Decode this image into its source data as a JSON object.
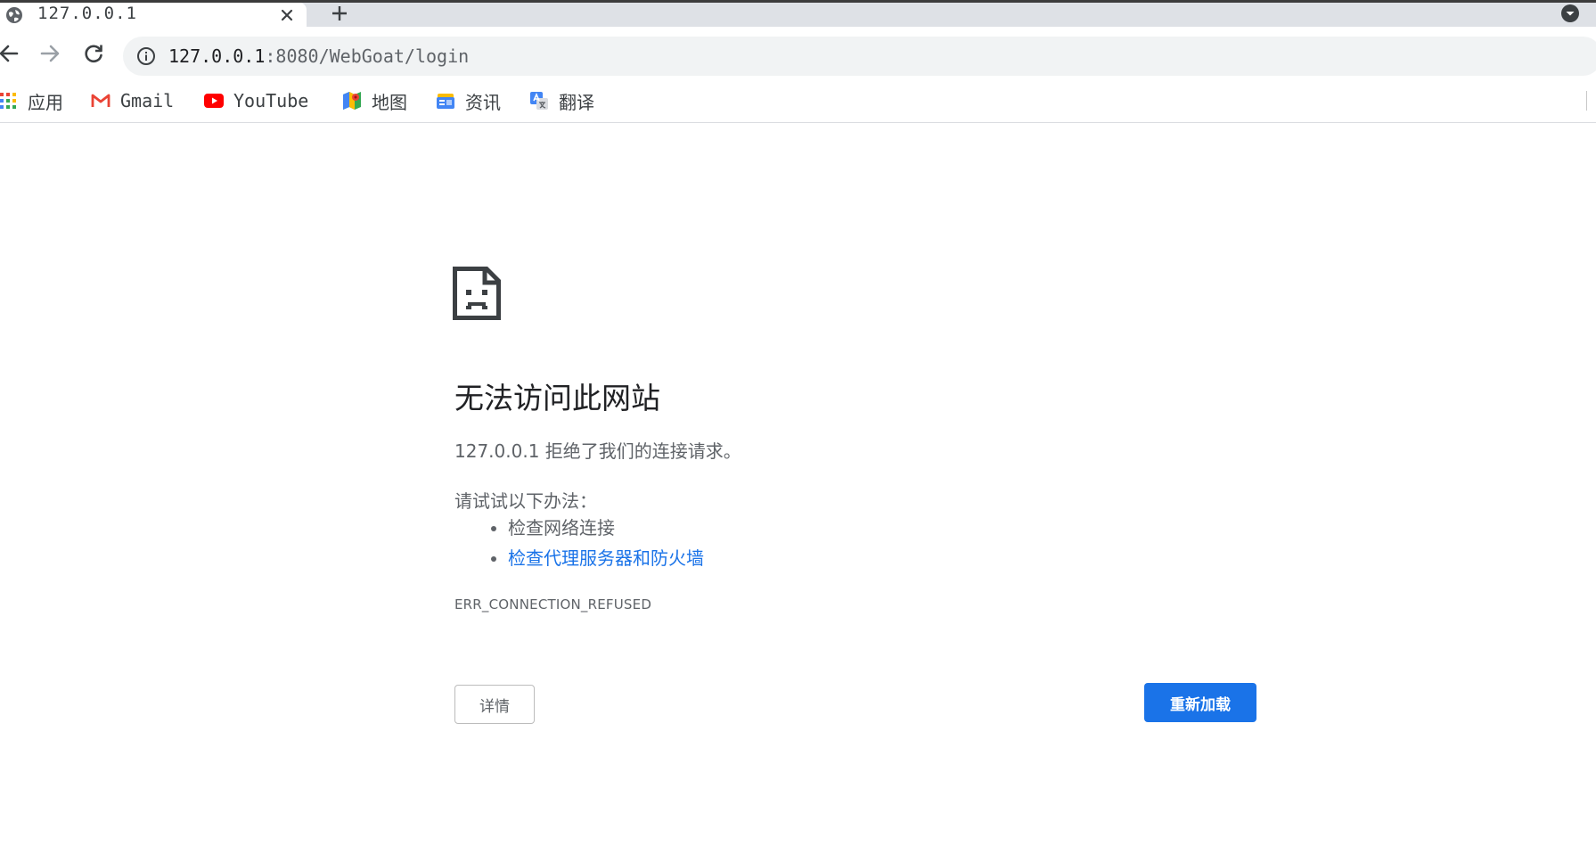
{
  "tab": {
    "title": "127.0.0.1",
    "favicon": "globe-icon",
    "close_icon": "close-icon",
    "new_tab_icon": "plus-icon"
  },
  "toolbar": {
    "back_icon": "arrow-left-icon",
    "forward_icon": "arrow-right-icon",
    "reload_icon": "reload-icon",
    "site_info_icon": "info-icon",
    "url_host": "127.0.0.1",
    "url_path": ":8080/WebGoat/login"
  },
  "bookmarks": {
    "items": [
      {
        "label": "应用",
        "icon": "apps-grid-icon"
      },
      {
        "label": "Gmail",
        "icon": "gmail-icon"
      },
      {
        "label": "YouTube",
        "icon": "youtube-icon"
      },
      {
        "label": "地图",
        "icon": "maps-icon"
      },
      {
        "label": "资讯",
        "icon": "news-icon"
      },
      {
        "label": "翻译",
        "icon": "translate-icon"
      }
    ]
  },
  "error": {
    "icon": "sad-page-icon",
    "title": "无法访问此网站",
    "description": "127.0.0.1 拒绝了我们的连接请求。",
    "suggestions_label": "请试试以下办法：",
    "suggestions": [
      {
        "text": "检查网络连接",
        "is_link": false
      },
      {
        "text": "检查代理服务器和防火墙",
        "is_link": true
      }
    ],
    "code": "ERR_CONNECTION_REFUSED",
    "details_label": "详情",
    "reload_label": "重新加载"
  },
  "colors": {
    "link": "#1a73e8",
    "primary_button": "#1a73e8",
    "text_secondary": "#5f6368",
    "text_primary": "#202124",
    "tab_strip": "#dee1e6",
    "omnibox": "#f1f3f4"
  }
}
